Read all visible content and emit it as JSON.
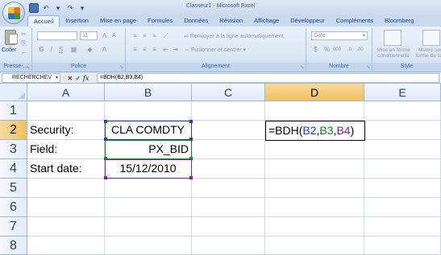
{
  "window": {
    "title": "Classeur1 - Microsoft Excel"
  },
  "quick_access": {
    "save_icon": "save-icon",
    "undo_icon": "undo-icon",
    "redo_icon": "redo-icon"
  },
  "ribbon_tabs": [
    "Accueil",
    "Insertion",
    "Mise en page",
    "Formules",
    "Données",
    "Révision",
    "Affichage",
    "Développeur",
    "Compléments",
    "Bloomberg"
  ],
  "ribbon": {
    "clipboard": {
      "paste_label": "Coller",
      "group_label": "Presse-..."
    },
    "font": {
      "font_size": "11",
      "group_label": "Police"
    },
    "alignment": {
      "wrap_text": "Renvoyer à la ligne automatiquement",
      "merge_center": "Fusionner et centrer",
      "group_label": "Alignement"
    },
    "number": {
      "format": "Date",
      "group_label": "Nombre"
    },
    "styles": {
      "conditional": "Mise en forme conditionnelle",
      "table": "Mettre sous forme de table",
      "group_label": "Style"
    }
  },
  "formula_bar": {
    "name_box": "RECHERCHEV",
    "formula": "=BDH(B2,B3,B4)"
  },
  "sheet": {
    "columns": [
      "A",
      "B",
      "C",
      "D",
      "E"
    ],
    "rows": [
      "1",
      "2",
      "3",
      "4",
      "5",
      "6",
      "7",
      "8"
    ],
    "cells": {
      "A2": "Security:",
      "B2": "CLA COMDTY",
      "A3": "Field:",
      "B3": "PX_BID",
      "A4": "Start date:",
      "B4": "15/12/2010"
    },
    "editing": {
      "cell": "D2",
      "prefix": "=BDH(",
      "ref1": "B2",
      "sep1": ",",
      "ref2": "B3",
      "sep2": ",",
      "ref3": "B4",
      "suffix": ")"
    }
  },
  "colors": {
    "ref_blue": "#1f3cd6",
    "ref_green": "#0a8a18",
    "ref_purple": "#8a1aa8",
    "selected_header": "#f1c15f"
  }
}
